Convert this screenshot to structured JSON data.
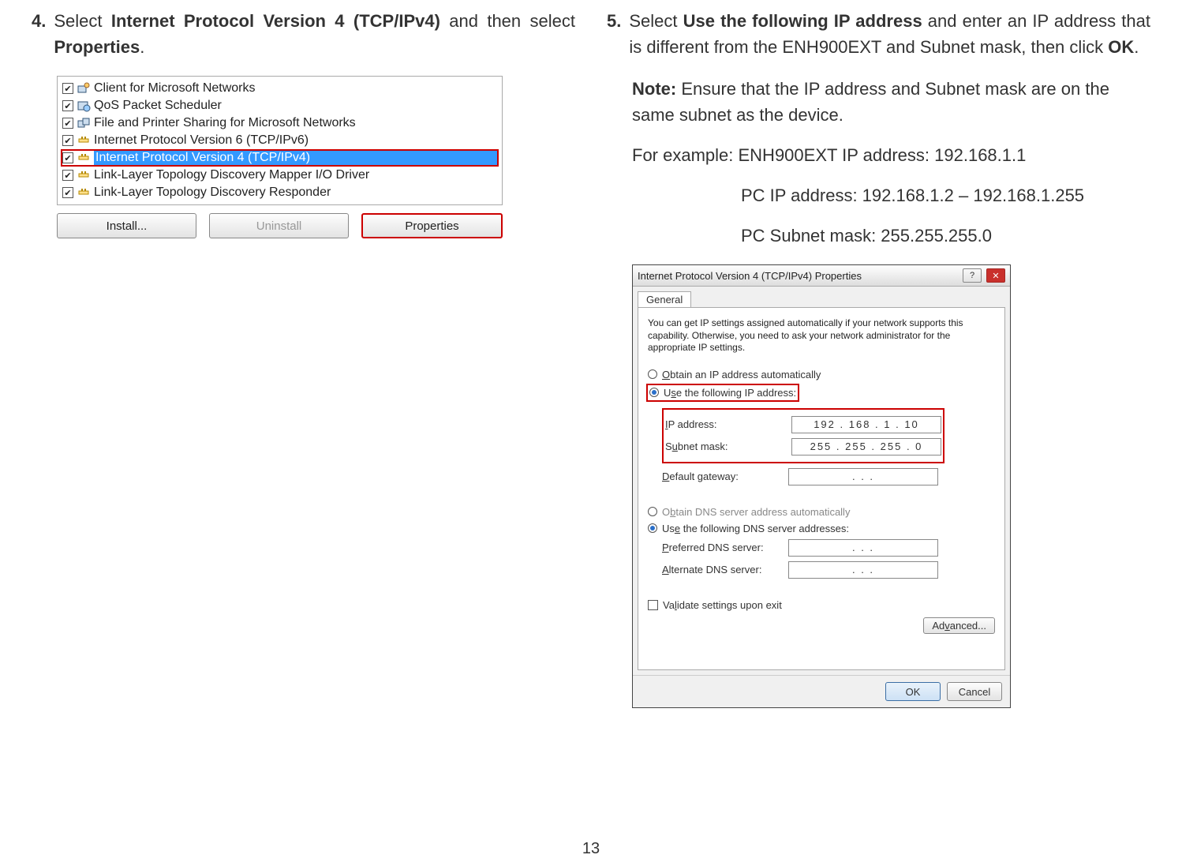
{
  "page_number": "13",
  "left": {
    "step_num": "4.",
    "step_prefix": "Select ",
    "step_bold1": "Internet Protocol Version 4 (TCP/IPv4)",
    "step_mid": " and then select ",
    "step_bold2": "Properties",
    "step_suffix": ".",
    "list_items": [
      {
        "checked": true,
        "type": "client",
        "label": "Client for Microsoft Networks"
      },
      {
        "checked": true,
        "type": "qos",
        "label": "QoS Packet Scheduler"
      },
      {
        "checked": true,
        "type": "fps",
        "label": "File and Printer Sharing for Microsoft Networks"
      },
      {
        "checked": true,
        "type": "proto",
        "label": "Internet Protocol Version 6 (TCP/IPv6)"
      },
      {
        "checked": true,
        "type": "proto",
        "label": "Internet Protocol Version 4 (TCP/IPv4)",
        "highlighted": true
      },
      {
        "checked": true,
        "type": "proto",
        "label": "Link-Layer Topology Discovery Mapper I/O Driver"
      },
      {
        "checked": true,
        "type": "proto",
        "label": "Link-Layer Topology Discovery Responder"
      }
    ],
    "buttons": {
      "install": "Install...",
      "uninstall": "Uninstall",
      "properties": "Properties"
    }
  },
  "right": {
    "step_num": "5.",
    "step_prefix": "Select ",
    "step_bold1": "Use the following IP address",
    "step_mid1": " and enter an IP address that is different from the ENH900EXT and Subnet mask, then click ",
    "step_bold2": "OK",
    "step_suffix": ".",
    "note_bold": "Note:",
    "note_text": " Ensure that the IP address and Subnet mask are on the same subnet as the device.",
    "example_line": "For example: ENH900EXT IP address: 192.168.1.1",
    "pc_ip_line": "PC IP address: 192.168.1.2 – 192.168.1.255",
    "pc_subnet_line": "PC Subnet mask: 255.255.255.0",
    "dialog": {
      "title": "Internet Protocol Version 4 (TCP/IPv4) Properties",
      "tab": "General",
      "description": "You can get IP settings assigned automatically if your network supports this capability. Otherwise, you need to ask your network administrator for the appropriate IP settings.",
      "radio_obtain_ip": "Obtain an IP address automatically",
      "radio_use_ip": "Use the following IP address:",
      "ip_label": "IP address:",
      "ip_value": "192 . 168 .   1   .  10",
      "subnet_label": "Subnet mask:",
      "subnet_value": "255 . 255 . 255 .   0",
      "gateway_label": "Default gateway:",
      "gateway_value": ".       .       .",
      "radio_obtain_dns": "Obtain DNS server address automatically",
      "radio_use_dns": "Use the following DNS server addresses:",
      "pref_dns_label": "Preferred DNS server:",
      "pref_dns_value": ".       .       .",
      "alt_dns_label": "Alternate DNS server:",
      "alt_dns_value": ".       .       .",
      "validate_label": "Validate settings upon exit",
      "advanced": "Advanced...",
      "ok": "OK",
      "cancel": "Cancel"
    }
  }
}
